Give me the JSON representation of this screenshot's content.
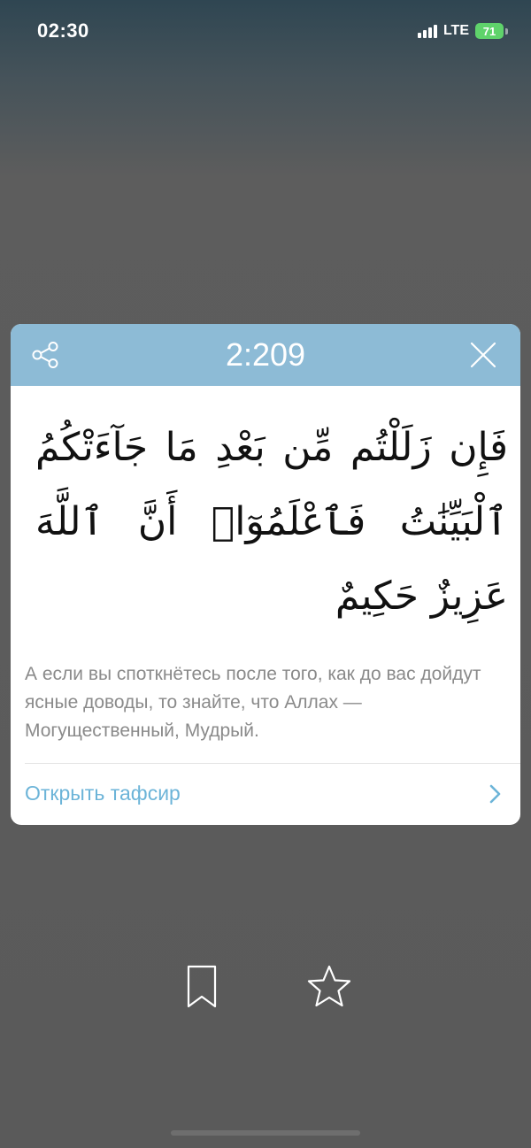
{
  "status_bar": {
    "time": "02:30",
    "network": "LTE",
    "battery": "71"
  },
  "ayah_card": {
    "header": {
      "ayah_number": "2:209",
      "share_icon": "share-icon",
      "close_icon": "close-icon"
    },
    "arabic": "فَإِن زَلَلْتُم مِّن بَعْدِ مَا جَآءَتْكُمُ ٱلْبَيِّنَٰتُ فَٱعْلَمُوٓا۟ أَنَّ ٱللَّهَ عَزِيزٌ حَكِيمٌ",
    "translation": "А если вы споткнётесь после того, как до вас дойдут ясные доводы, то знайте, что Аллах — Могущественный, Мудрый.",
    "tafsir_link": "Открыть тафсир",
    "accent_color": "#6cb4d8",
    "header_color": "#8dbbd6"
  },
  "bottom_actions": {
    "bookmark_icon": "bookmark-icon",
    "star_icon": "star-icon"
  }
}
